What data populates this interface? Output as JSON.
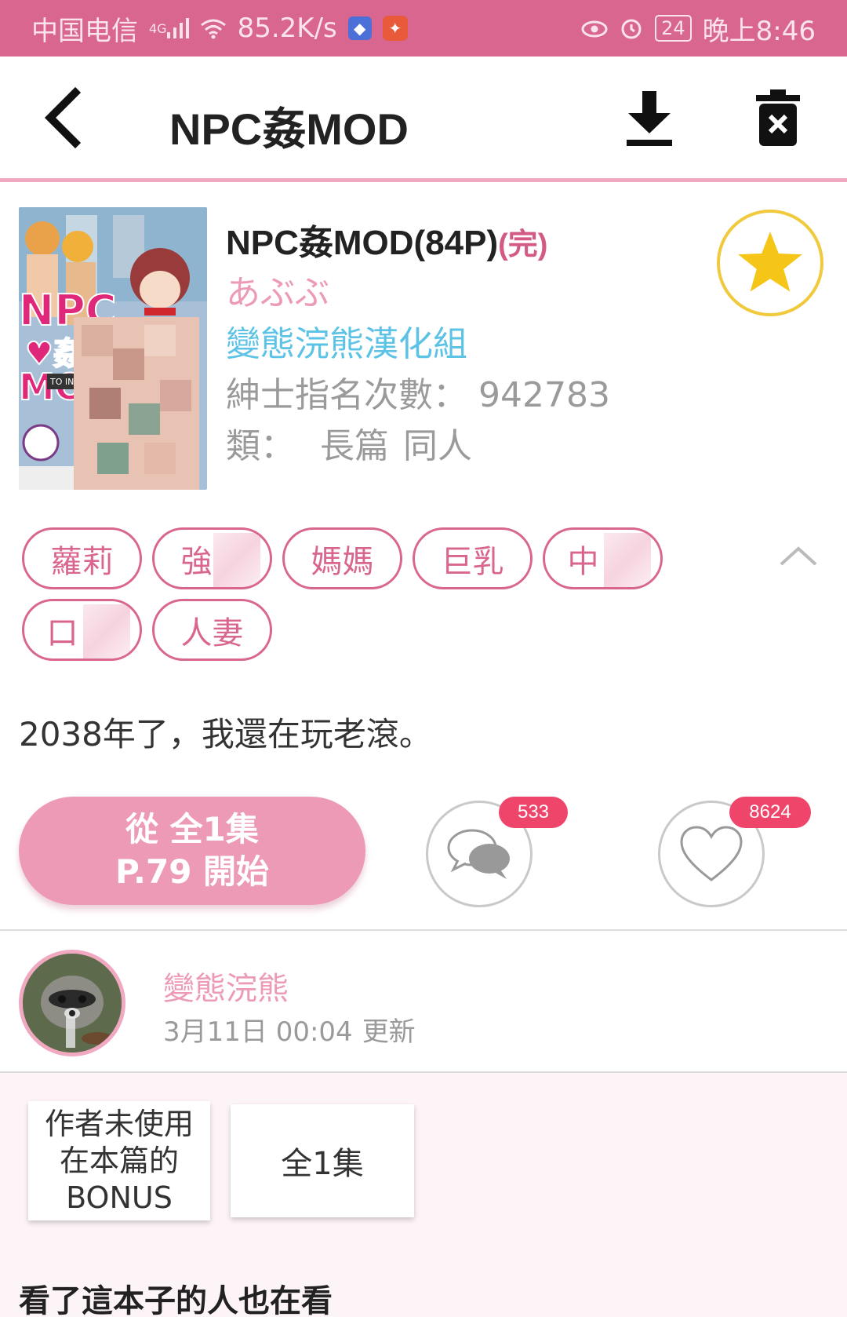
{
  "status_bar": {
    "carrier": "中国电信",
    "network": "4G",
    "speed": "85.2K/s",
    "battery": "24",
    "time": "晚上8:46"
  },
  "header": {
    "title": "NPC姦MOD",
    "icons": [
      "back-arrow-icon",
      "download-icon",
      "delete-icon"
    ]
  },
  "book": {
    "title": "NPC姦MOD(84P)",
    "status": "(完)",
    "author": "あぶぶ",
    "group": "變態浣熊漢化組",
    "count_label": "紳士指名次數：",
    "count_value": "942783",
    "category_label": "類：",
    "category_values": [
      "長篇",
      "同人"
    ]
  },
  "tags": [
    "蘿莉",
    "強",
    "媽媽",
    "巨乳",
    "中",
    "口",
    "人妻"
  ],
  "description": "2038年了，我還在玩老滾。",
  "actions": {
    "start_line1": "從 全1集",
    "start_line2": "P.79 開始",
    "comment_count": "533",
    "like_count": "8624"
  },
  "uploader": {
    "name": "變態浣熊",
    "date": "3月11日 00:04",
    "update_label": "更新"
  },
  "episodes": {
    "bonus_lines": [
      "作者未使用",
      "在本篇的",
      "BONUS"
    ],
    "all_label": "全1集"
  },
  "related_title": "看了這本子的人也在看",
  "colors": {
    "status_bar": "#d9668f",
    "pink_accent": "#ed9ab6",
    "tag_border": "#d9668f",
    "group_link": "#5cc3e6",
    "star": "#f5c518",
    "badge": "#f0456b"
  }
}
